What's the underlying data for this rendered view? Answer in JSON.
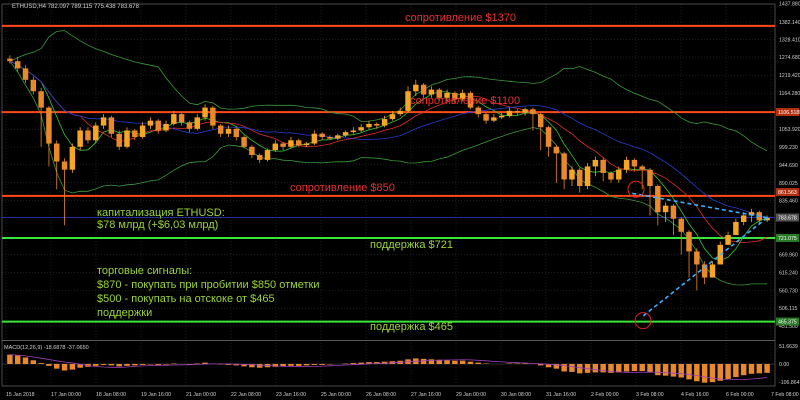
{
  "header": {
    "symbol_line": "ETHUSD,H4  782.097 789.115 775.438 783.678"
  },
  "macd_label": "MACD(12,26,9) -18.6878 -37.0650",
  "annotations": {
    "res_1370": "сопротивление $1370",
    "res_1100": "сопротивление $1100",
    "res_850": "сопротивление $850",
    "cap_line1": "капитализация ETHUSD:",
    "cap_line2": "$78 млрд (+$6,03 млрд)",
    "sup_721": "поддержка $721",
    "signals_title": "торговые сигналы:",
    "signal_1": "$870 - покупать при пробитии $850 отметки",
    "signal_2": "$500 - покупать на отскоке от $465",
    "signal_3": "поддержки",
    "sup_465": "поддержка $465"
  },
  "colors": {
    "background": "#000000",
    "grid": "#3a3a3a",
    "candle_up": "#f5a623",
    "candle_down": "#e8892b",
    "resistance": "#ff4a1a",
    "support": "#39e639",
    "annotation_resistance": "#e83030",
    "annotation_support": "#9cd23c",
    "bollinger": "#3c9a3c",
    "ma_fast": "#39c639",
    "ma_mid": "#e0302a",
    "ma_slow": "#2a3cd0",
    "forecast": "#3ab0ff",
    "macd_hist": "#e8892b",
    "macd_signal": "#a040c0",
    "axis_text": "#d0d0d0",
    "price_tag": "#b03010"
  },
  "chart_data": {
    "type": "candlestick",
    "symbol": "ETHUSD",
    "timeframe": "H4",
    "ylim": [
      415.0,
      1437.0
    ],
    "y_ticks": [
      1437.88,
      1382.14,
      1328.41,
      1274.68,
      1219.42,
      1164.28,
      1106.518,
      1053.92,
      999.23,
      944.69,
      890.025,
      861.563,
      835.46,
      783.678,
      721.075,
      669.96,
      615.24,
      560.73,
      506.115,
      465.375,
      451.5
    ],
    "price_tags": [
      {
        "value": 1106.518,
        "label": "1106.518",
        "color": "#b03010"
      },
      {
        "value": 861.563,
        "label": "861.563",
        "color": "#b03010"
      },
      {
        "value": 783.678,
        "label": "783.678",
        "color": "#555555"
      },
      {
        "value": 721.075,
        "label": "721.075",
        "color": "#2a7a2a"
      },
      {
        "value": 465.375,
        "label": "465.375",
        "color": "#2a7a2a"
      }
    ],
    "x_ticks": [
      "15 Jan 2018",
      "17 Jan 00:00",
      "18 Jan 08:00",
      "19 Jan 16:00",
      "21 Jan 00:00",
      "22 Jan 08:00",
      "23 Jan 16:00",
      "25 Jan 00:00",
      "26 Jan 08:00",
      "27 Jan 16:00",
      "29 Jan 00:00",
      "30 Jan 08:00",
      "31 Jan 16:00",
      "2 Feb 00:00",
      "3 Feb 08:00",
      "4 Feb 16:00",
      "6 Feb 00:00",
      "7 Feb 08:00"
    ],
    "levels": [
      {
        "kind": "resistance",
        "value": 1370
      },
      {
        "kind": "resistance",
        "value": 1106
      },
      {
        "kind": "resistance",
        "value": 850
      },
      {
        "kind": "current",
        "value": 783.678
      },
      {
        "kind": "support",
        "value": 721
      },
      {
        "kind": "support",
        "value": 465
      }
    ],
    "candles_close": [
      1262,
      1240,
      1205,
      1170,
      1120,
      1010,
      955,
      930,
      1000,
      1050,
      1020,
      1065,
      1090,
      1040,
      1000,
      1050,
      1030,
      1065,
      1080,
      1050,
      1070,
      1100,
      1075,
      1055,
      1090,
      1120,
      1065,
      1040,
      1055,
      1030,
      1000,
      975,
      960,
      990,
      1010,
      1000,
      1020,
      1005,
      1010,
      1040,
      1030,
      1025,
      1035,
      1045,
      1050,
      1060,
      1070,
      1065,
      1085,
      1100,
      1110,
      1170,
      1190,
      1160,
      1175,
      1150,
      1165,
      1145,
      1165,
      1120,
      1100,
      1080,
      1090,
      1095,
      1110,
      1105,
      1115,
      1100,
      1060,
      1000,
      980,
      900,
      930,
      880,
      940,
      960,
      920,
      900,
      930,
      960,
      940,
      930,
      880,
      800,
      820,
      780,
      740,
      680,
      640,
      600,
      640,
      700,
      730,
      770,
      790,
      800,
      775,
      783
    ],
    "candles_open": [
      1270,
      1262,
      1240,
      1205,
      1170,
      1120,
      1010,
      955,
      930,
      1000,
      1050,
      1020,
      1065,
      1090,
      1040,
      1000,
      1050,
      1030,
      1065,
      1080,
      1050,
      1070,
      1100,
      1075,
      1055,
      1090,
      1120,
      1065,
      1040,
      1055,
      1030,
      1000,
      975,
      960,
      990,
      1010,
      1000,
      1020,
      1005,
      1010,
      1040,
      1030,
      1025,
      1035,
      1045,
      1050,
      1060,
      1070,
      1065,
      1085,
      1100,
      1110,
      1170,
      1190,
      1160,
      1175,
      1150,
      1165,
      1145,
      1165,
      1120,
      1100,
      1080,
      1090,
      1095,
      1110,
      1105,
      1115,
      1100,
      1060,
      1000,
      980,
      900,
      930,
      880,
      940,
      960,
      920,
      900,
      930,
      960,
      940,
      930,
      880,
      800,
      820,
      780,
      740,
      680,
      640,
      600,
      640,
      700,
      730,
      770,
      790,
      800,
      775
    ],
    "candles_high": [
      1280,
      1275,
      1250,
      1215,
      1180,
      1125,
      1020,
      965,
      1010,
      1060,
      1060,
      1075,
      1100,
      1095,
      1050,
      1060,
      1055,
      1075,
      1090,
      1085,
      1080,
      1110,
      1105,
      1080,
      1100,
      1130,
      1125,
      1070,
      1065,
      1060,
      1035,
      1005,
      980,
      995,
      1020,
      1015,
      1030,
      1025,
      1015,
      1050,
      1045,
      1035,
      1040,
      1050,
      1060,
      1070,
      1080,
      1075,
      1095,
      1110,
      1120,
      1185,
      1205,
      1195,
      1185,
      1180,
      1175,
      1170,
      1175,
      1170,
      1125,
      1105,
      1100,
      1105,
      1120,
      1115,
      1120,
      1120,
      1105,
      1065,
      1005,
      985,
      940,
      935,
      950,
      970,
      965,
      925,
      940,
      970,
      965,
      945,
      935,
      885,
      830,
      825,
      785,
      745,
      690,
      650,
      650,
      710,
      740,
      780,
      800,
      810,
      805,
      790
    ],
    "candles_low": [
      1255,
      1230,
      1195,
      1160,
      1000,
      940,
      870,
      760,
      920,
      990,
      1010,
      1010,
      1055,
      1030,
      990,
      995,
      1020,
      1025,
      1055,
      1040,
      1045,
      1065,
      1065,
      1045,
      1050,
      1080,
      1055,
      1030,
      1030,
      1020,
      995,
      965,
      950,
      955,
      985,
      990,
      995,
      1000,
      1000,
      1005,
      1020,
      1020,
      1020,
      1030,
      1040,
      1045,
      1055,
      1055,
      1060,
      1080,
      1095,
      1105,
      1155,
      1150,
      1150,
      1140,
      1140,
      1135,
      1140,
      1115,
      1090,
      1070,
      1075,
      1085,
      1090,
      1095,
      1095,
      1050,
      990,
      970,
      890,
      870,
      880,
      860,
      870,
      910,
      895,
      890,
      890,
      920,
      925,
      870,
      790,
      760,
      770,
      730,
      670,
      600,
      560,
      580,
      600,
      660,
      700,
      730,
      760,
      770,
      765,
      770
    ],
    "macd_hist": [
      20,
      18,
      14,
      8,
      2,
      -4,
      -10,
      -14,
      -12,
      -8,
      -6,
      -4,
      -2,
      -3,
      -5,
      -4,
      -3,
      -2,
      -1,
      -2,
      -1,
      1,
      0,
      -1,
      1,
      3,
      1,
      -1,
      -2,
      -3,
      -5,
      -7,
      -8,
      -7,
      -6,
      -5,
      -4,
      -4,
      -3,
      -2,
      -2,
      -1,
      0,
      1,
      2,
      3,
      4,
      4,
      5,
      6,
      7,
      10,
      12,
      11,
      10,
      9,
      8,
      7,
      7,
      5,
      3,
      1,
      0,
      0,
      1,
      1,
      1,
      0,
      -3,
      -7,
      -10,
      -16,
      -17,
      -20,
      -19,
      -18,
      -18,
      -19,
      -18,
      -16,
      -15,
      -15,
      -18,
      -24,
      -25,
      -27,
      -29,
      -33,
      -37,
      -40,
      -39,
      -36,
      -32,
      -28,
      -24,
      -21,
      -20,
      -19
    ]
  }
}
